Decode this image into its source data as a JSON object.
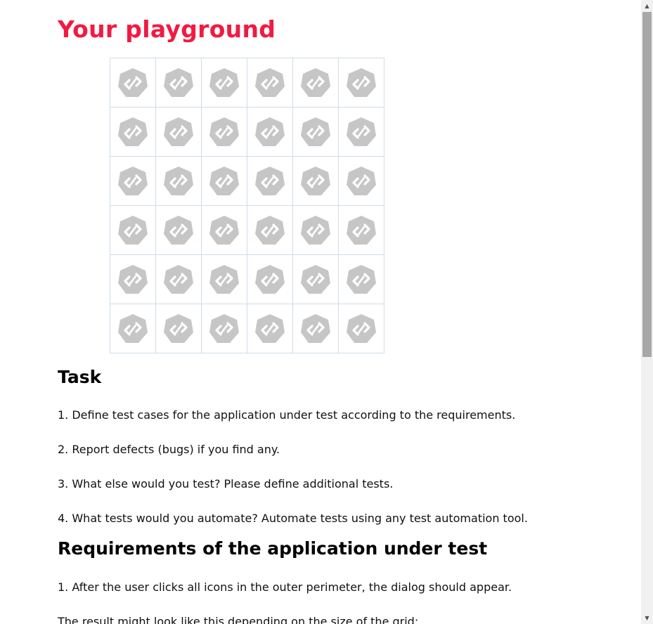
{
  "page": {
    "title": "Your playground"
  },
  "grid": {
    "rows": 6,
    "cols": 6,
    "icon": "code-hexagon-icon",
    "icon_color": "#c6c6c6",
    "border_color": "#cfdce8"
  },
  "task": {
    "heading": "Task",
    "items": [
      "1. Define test cases for the application under test according to the requirements.",
      "2. Report defects (bugs) if you find any.",
      "3. What else would you test? Please define additional tests.",
      "4. What tests would you automate? Automate tests using any test automation tool."
    ]
  },
  "requirements": {
    "heading": "Requirements of the application under test",
    "items": [
      "1. After the user clicks all icons in the outer perimeter, the dialog should appear.",
      "The result might look like this depending on the size of the grid:"
    ]
  },
  "colors": {
    "title": "#f21a41",
    "scrollbar_thumb": "#a8a8a8"
  },
  "scrollbar": {
    "up_glyph": "▲",
    "down_glyph": "▼"
  }
}
